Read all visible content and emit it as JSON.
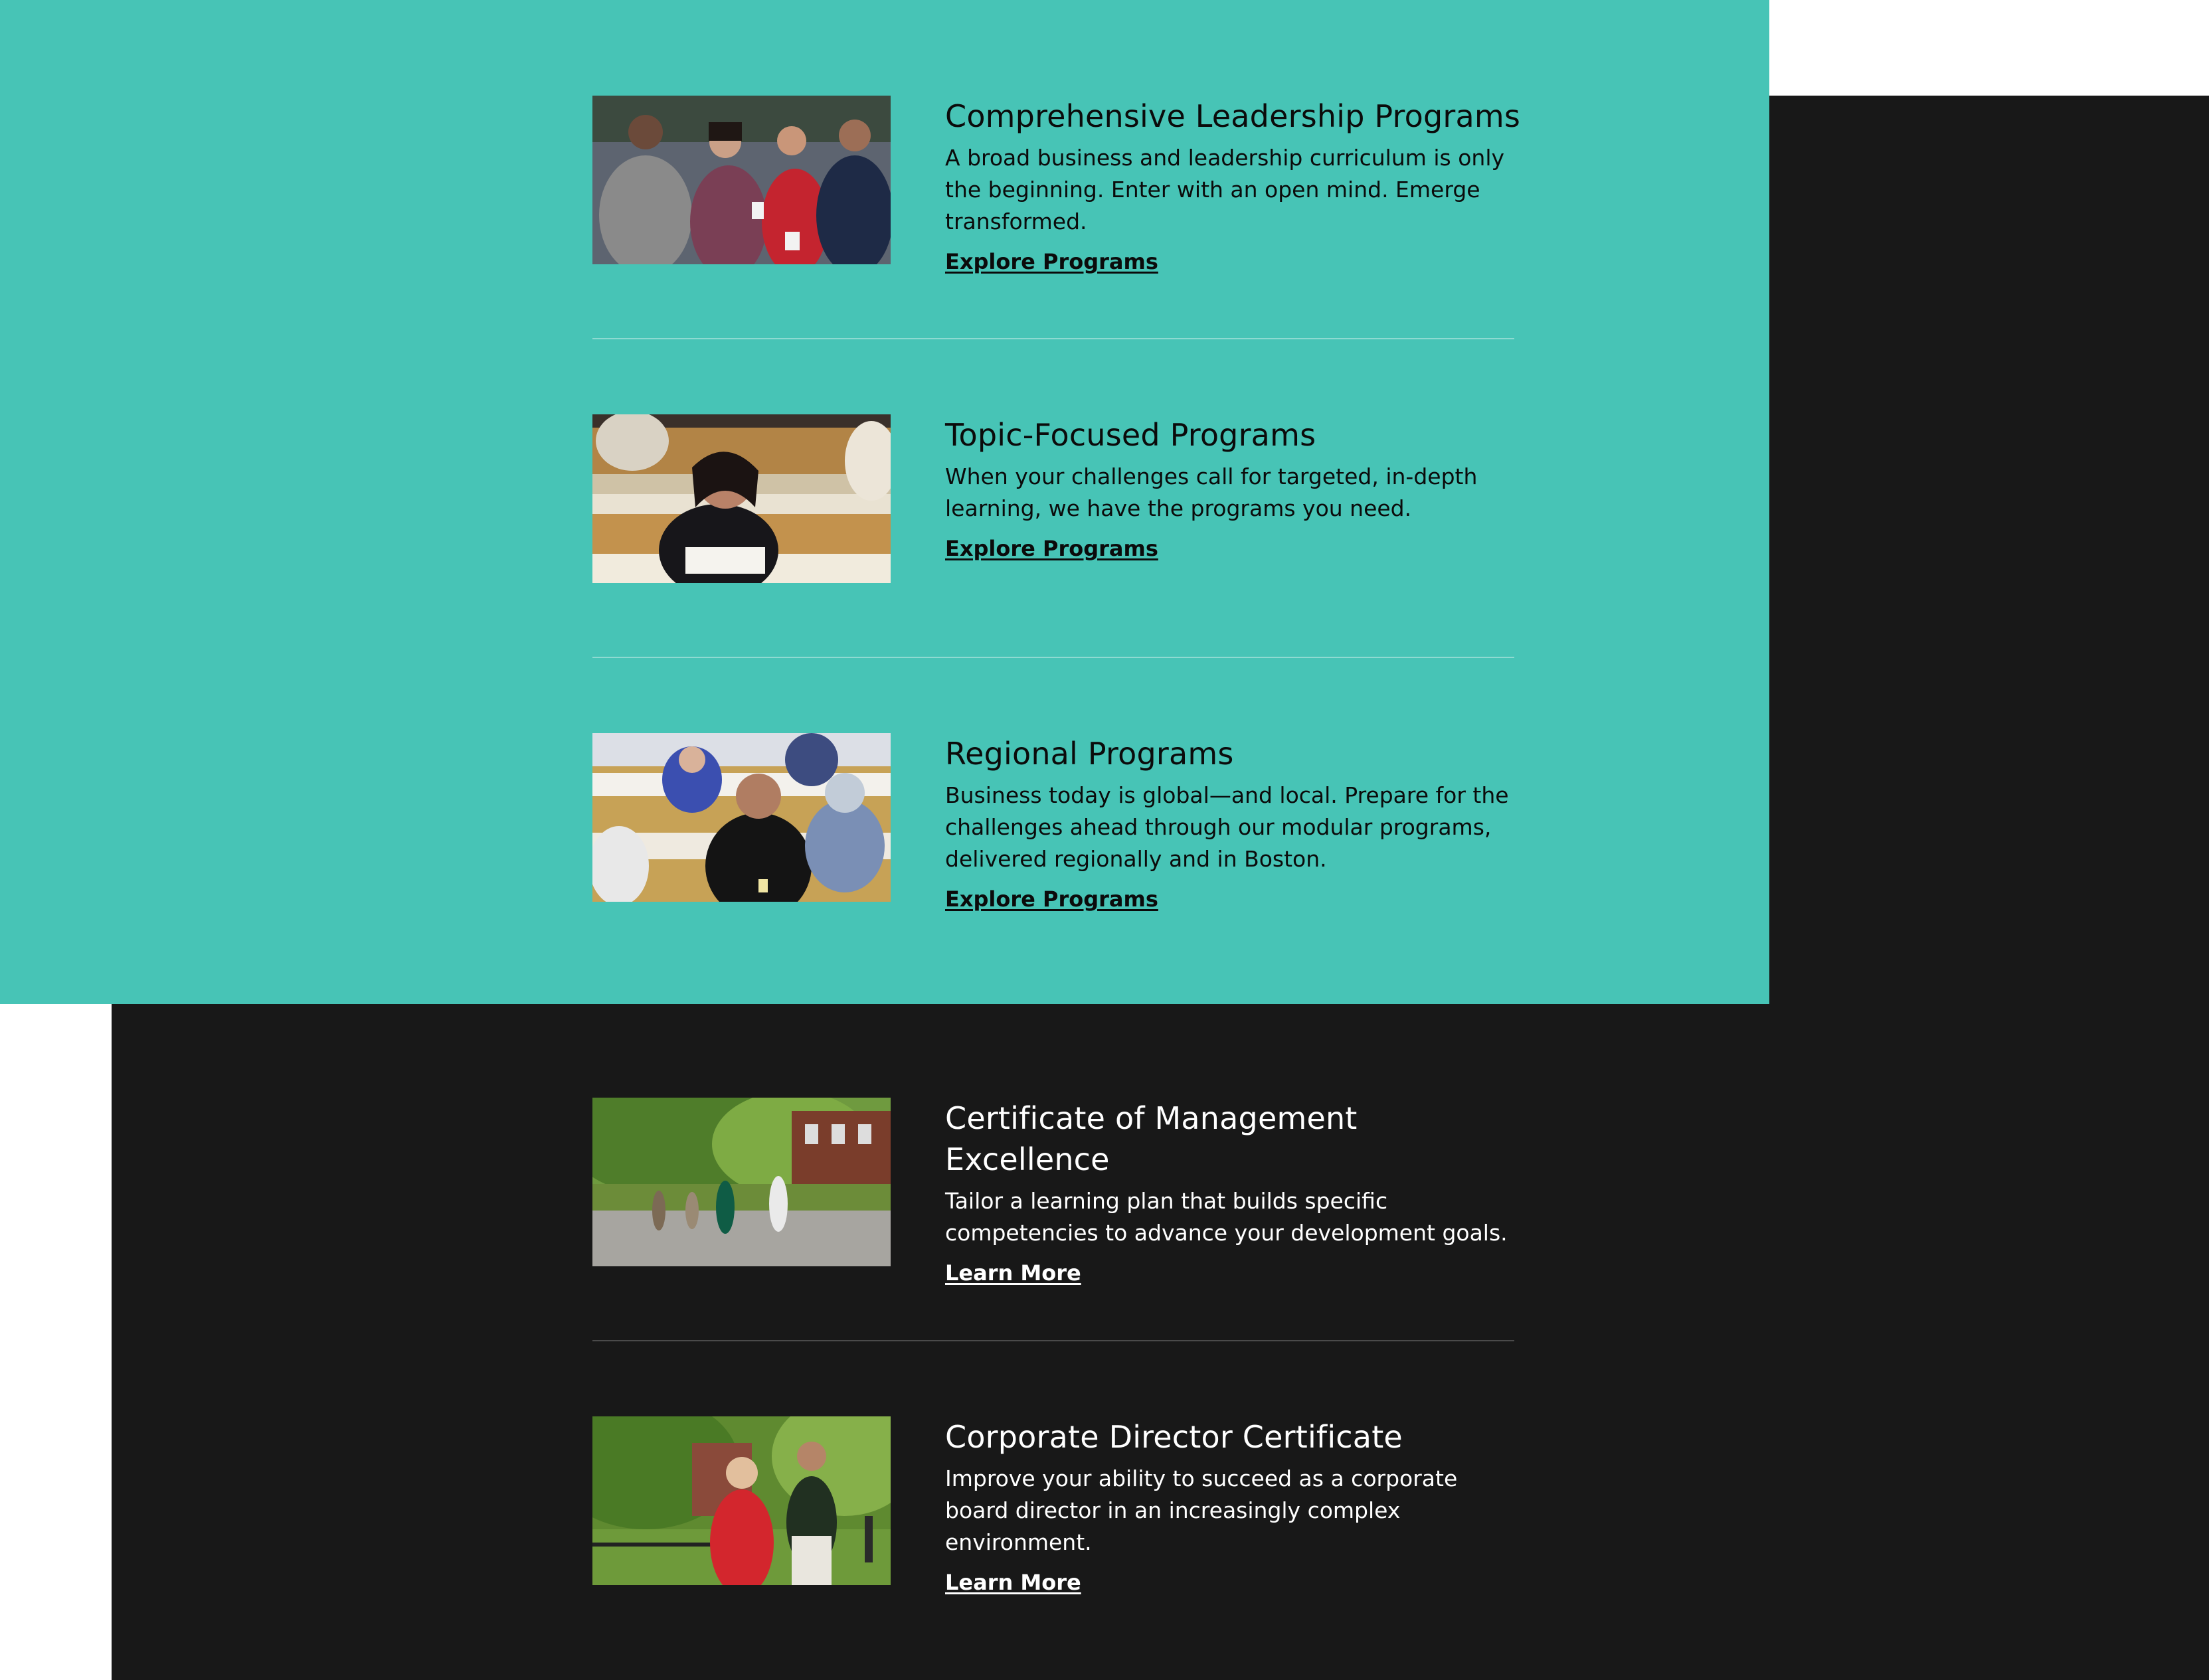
{
  "leadership_programs": {
    "items": [
      {
        "title": "Comprehensive Leadership Programs",
        "description": "A broad business and leadership curriculum is only the beginning. Enter with an open mind. Emerge transformed.",
        "link_label": "Explore Programs",
        "image": "photo-networking-group"
      },
      {
        "title": "Topic-Focused Programs",
        "description": "When your challenges call for targeted, in-depth learning, we have the programs you need.",
        "link_label": "Explore Programs",
        "image": "photo-classroom-woman"
      },
      {
        "title": "Regional Programs",
        "description": "Business today is global—and local. Prepare for the challenges ahead through our modular programs, delivered regionally and in Boston.",
        "link_label": "Explore Programs",
        "image": "photo-classroom-participants"
      }
    ]
  },
  "certificates": {
    "items": [
      {
        "title": "Certificate of Management Excellence",
        "description": "Tailor a learning plan that builds specific competencies to advance your development goals.",
        "link_label": "Learn More",
        "image": "photo-campus-walkway"
      },
      {
        "title": "Corporate Director Certificate",
        "description": "Improve your ability to succeed as a corporate board director in an increasingly complex environment.",
        "link_label": "Learn More",
        "image": "photo-campus-pair-walking"
      }
    ]
  },
  "colors": {
    "teal_panel": "#47c4b6",
    "dark_panel": "#181818",
    "page_background": "#ffffff"
  }
}
